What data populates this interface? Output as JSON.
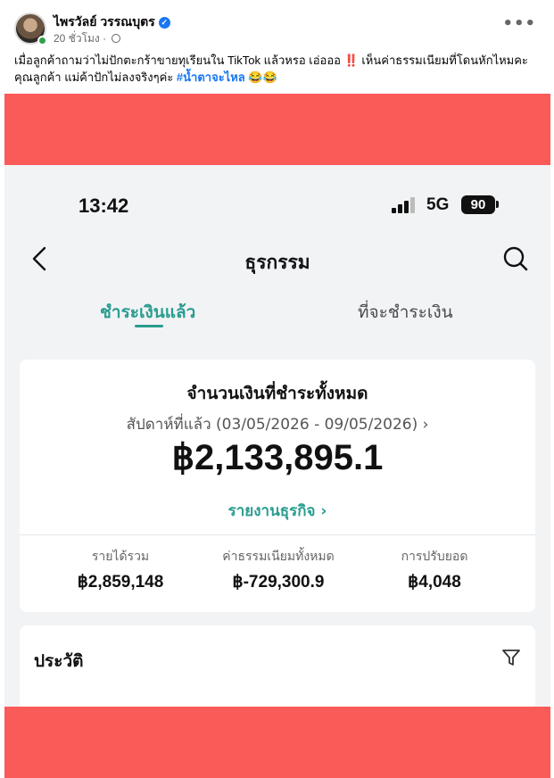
{
  "post": {
    "author": "ไพรวัลย์ วรรณบุตร",
    "time": "20 ชั่วโมง",
    "caption_main": "เมื่อลูกค้าถามว่าไม่ปักตะกร้าขายทุเรียนใน TikTok แล้วหรอ  เอ่อออ",
    "caption_bang": "‼️",
    "caption_tail": " เห็นค่าธรรมเนียมที่โดนหักไหมคะคุณลูกค้า  แม่ค้าปักไม่ลงจริงๆค่ะ ",
    "hashtag": "#น้ำตาจะไหล",
    "emoji": "😂😂"
  },
  "colors": {
    "red_band": "#fa5a58",
    "accent": "#2a9d8f",
    "fb_blue": "#1877f2"
  },
  "phone": {
    "status": {
      "time": "13:42",
      "network": "5G",
      "battery": "90"
    },
    "nav": {
      "title": "ธุรกรรม"
    },
    "tabs": [
      {
        "label": "ชำระเงินแล้ว",
        "active": true
      },
      {
        "label": "ที่จะชำระเงิน",
        "active": false
      }
    ],
    "summary": {
      "title": "จำนวนเงินที่ชำระทั้งหมด",
      "period": "สัปดาห์ที่แล้ว (03/05/2026 - 09/05/2026)  ›",
      "total": "฿2,133,895.1",
      "report_link": "รายงานธุรกิจ  ›",
      "stats": [
        {
          "label": "รายได้รวม",
          "value": "฿2,859,148"
        },
        {
          "label": "ค่าธรรมเนียมทั้งหมด",
          "value": "฿-729,300.9"
        },
        {
          "label": "การปรับยอด",
          "value": "฿4,048"
        }
      ]
    },
    "history": {
      "title": "ประวัติ"
    }
  },
  "icons": {
    "verified": "verified-badge-icon",
    "privacy": "globe-icon",
    "more": "more-options-icon",
    "back": "chevron-left-icon",
    "search": "search-icon",
    "filter": "filter-icon"
  }
}
